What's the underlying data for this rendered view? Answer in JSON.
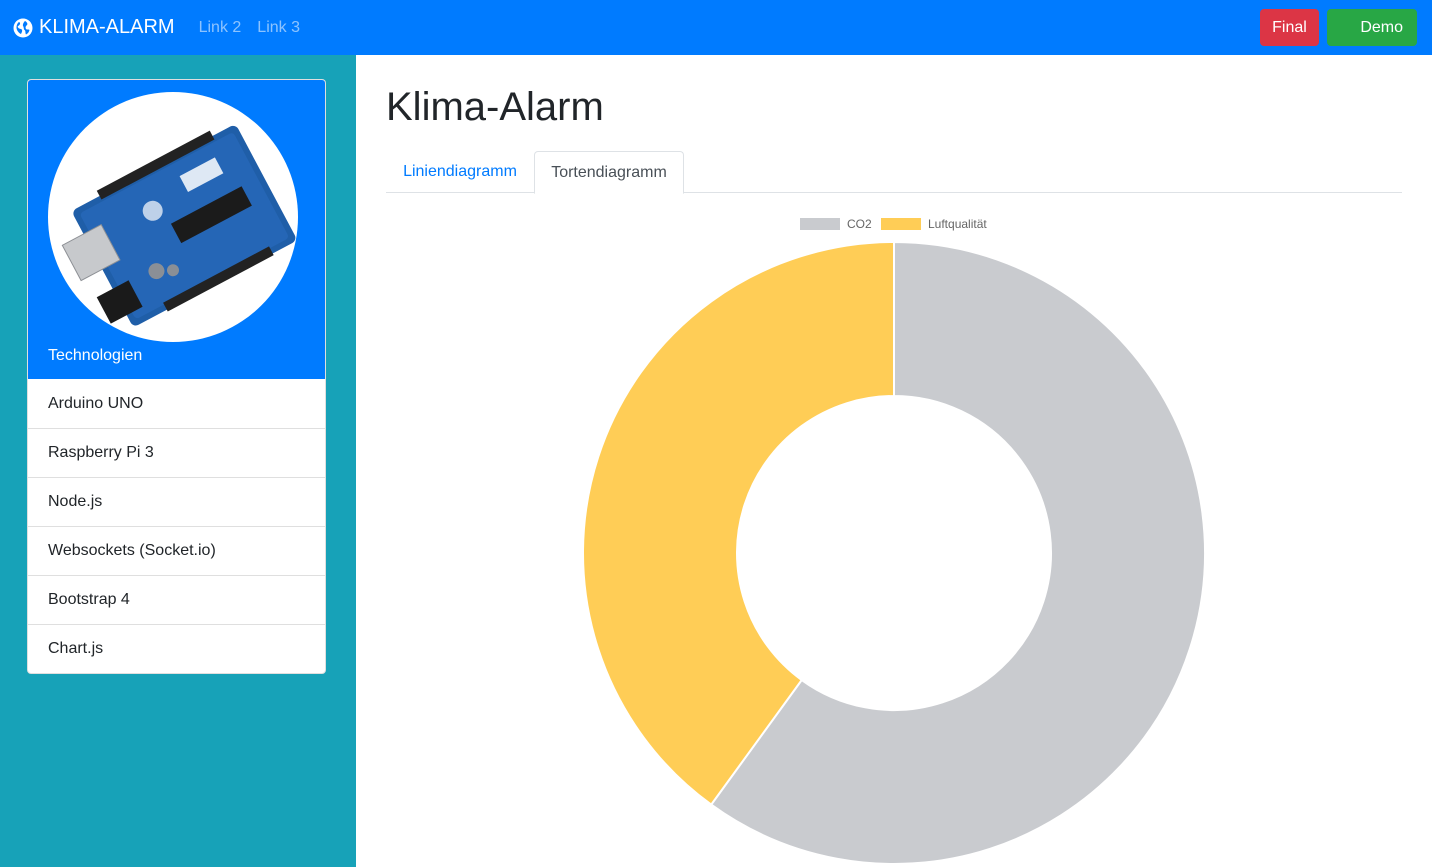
{
  "navbar": {
    "brand": "KLIMA-ALARM",
    "links": [
      "Link 2",
      "Link 3"
    ],
    "buttons": {
      "final": "Final",
      "demo": "Demo"
    }
  },
  "sidebar": {
    "card_title": "Technologien",
    "items": [
      "Arduino UNO",
      "Raspberry Pi 3",
      "Node.js",
      "Websockets (Socket.io)",
      "Bootstrap 4",
      "Chart.js"
    ]
  },
  "main": {
    "title": "Klima-Alarm",
    "tabs": [
      {
        "label": "Liniendiagramm",
        "active": false
      },
      {
        "label": "Tortendiagramm",
        "active": true
      }
    ]
  },
  "chart_data": {
    "type": "pie",
    "variant": "doughnut",
    "categories": [
      "CO2",
      "Luftqualität"
    ],
    "values": [
      60,
      40
    ],
    "colors": [
      "#c9cbcf",
      "#ffcd56"
    ],
    "legend": "top"
  }
}
